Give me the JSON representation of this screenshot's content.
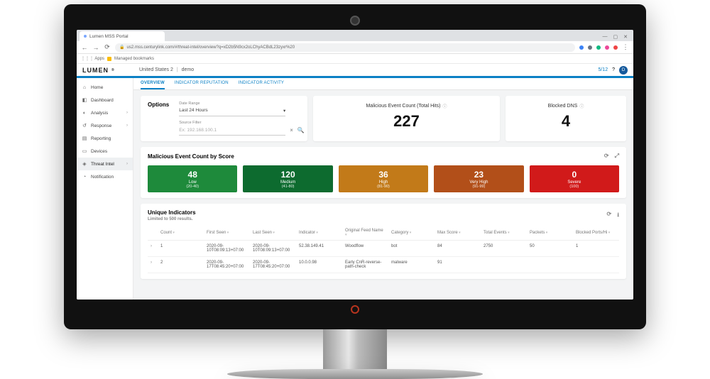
{
  "browser": {
    "tab_title": "Lumen MSS Portal",
    "url": "us2.mss.centurylink.com/#/threat-intel/overview?q=xD2b5N9cx2oLChyACBdL23zyxr%20",
    "bookmark": "Managed bookmarks"
  },
  "brand": {
    "name": "LUMEN",
    "reg": "®"
  },
  "tenant": {
    "region": "United States 2",
    "name": "demo"
  },
  "header": {
    "count": "5/12",
    "help": "?",
    "avatar": "D"
  },
  "sidebar": {
    "items": [
      {
        "label": "Home"
      },
      {
        "label": "Dashboard"
      },
      {
        "label": "Analysis"
      },
      {
        "label": "Response"
      },
      {
        "label": "Reporting"
      },
      {
        "label": "Devices"
      },
      {
        "label": "Threat Intel"
      },
      {
        "label": "Notification"
      }
    ]
  },
  "tabs": {
    "items": [
      {
        "label": "OVERVIEW"
      },
      {
        "label": "INDICATOR REPUTATION"
      },
      {
        "label": "INDICATOR ACTIVITY"
      }
    ]
  },
  "options": {
    "title": "Options",
    "daterange_label": "Date Range",
    "daterange_value": "Last 24 Hours",
    "filter_label": "Source Filter",
    "filter_placeholder": "Ex: 192.168.100.1"
  },
  "metrics": {
    "events": {
      "label": "Malicious Event Count (Total Hits)",
      "value": "227"
    },
    "blocked": {
      "label": "Blocked DNS",
      "value": "4"
    }
  },
  "scores": {
    "title": "Malicious Event Count by Score",
    "items": [
      {
        "count": "48",
        "label": "Low",
        "range": "(20-40)"
      },
      {
        "count": "120",
        "label": "Medium",
        "range": "(41-80)"
      },
      {
        "count": "36",
        "label": "High",
        "range": "(81-90)"
      },
      {
        "count": "23",
        "label": "Very High",
        "range": "(91-99)"
      },
      {
        "count": "0",
        "label": "Severe",
        "range": "(100)"
      }
    ]
  },
  "indicators": {
    "title": "Unique Indicators",
    "subtitle": "Limited to 500 results.",
    "columns": [
      "Count",
      "First Seen",
      "Last Seen",
      "Indicator",
      "Original Feed Name",
      "Category",
      "Max Score",
      "Total Events",
      "Packets",
      "Blocked Ports/Hi"
    ],
    "rows": [
      {
        "count": "1",
        "first_seen": "2020-09-\n10T08:09:13+07:00",
        "last_seen": "2020-09-\n10T08:09:13+07:00",
        "indicator": "52.38.149.41",
        "feed": "Woodflow",
        "category": "bot",
        "max_score": "84",
        "total_events": "2750",
        "packets": "50",
        "blocked": "1"
      },
      {
        "count": "2",
        "first_seen": "2020-09-\n17T08:45:20+07:00",
        "last_seen": "2020-09-\n17T08:45:20+07:00",
        "indicator": "10.0.0.98",
        "feed": "Early CnR-reverse-\npath-check",
        "category": "malware",
        "max_score": "91",
        "total_events": "",
        "packets": "",
        "blocked": ""
      }
    ]
  }
}
